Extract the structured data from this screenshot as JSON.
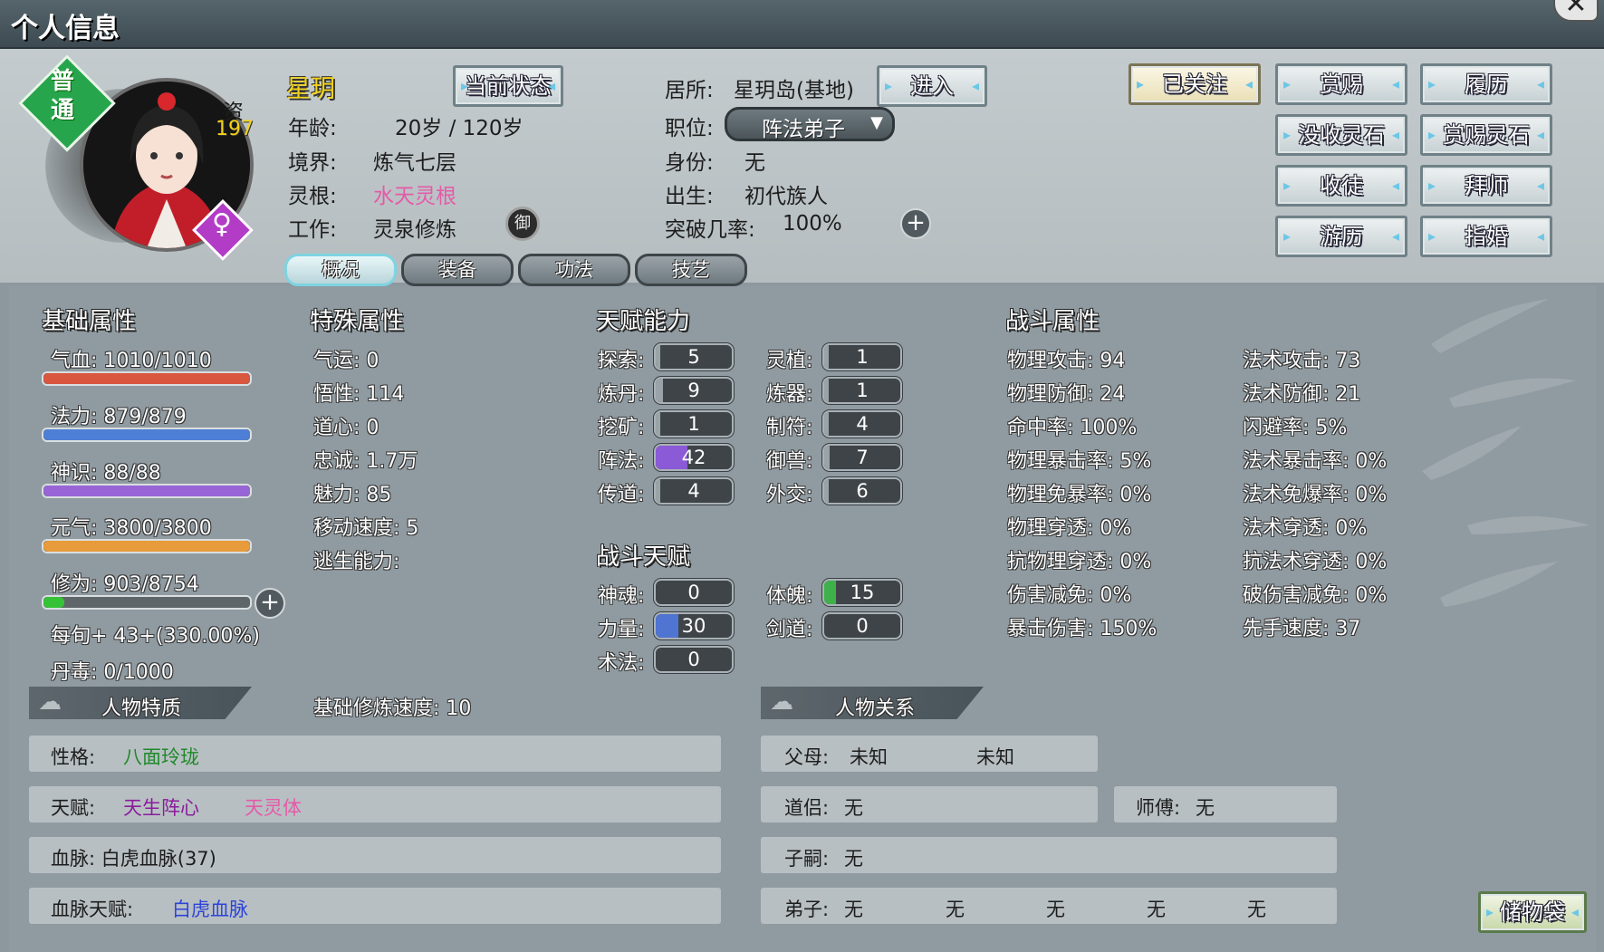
{
  "window": {
    "title": "个人信息"
  },
  "avatar": {
    "rank_badge": "普通",
    "zi_label": "资",
    "zi_value": "197",
    "gender_symbol": "♀"
  },
  "profile": {
    "name": "星玥",
    "status_button": "当前状态",
    "age_label": "年龄:",
    "age_value": "20岁 / 120岁",
    "realm_label": "境界:",
    "realm_value": "炼气七层",
    "root_label": "灵根:",
    "root_value": "水天灵根",
    "job_label": "工作:",
    "job_value": "灵泉修炼",
    "job_icon_text": "御",
    "residence_label": "居所:",
    "residence_value": "星玥岛(基地)",
    "enter_button": "进入",
    "position_label": "职位:",
    "position_value": "阵法弟子",
    "identity_label": "身份:",
    "identity_value": "无",
    "birth_label": "出生:",
    "birth_value": "初代族人",
    "breakthrough_label": "突破几率:",
    "breakthrough_value": "100%"
  },
  "actions": [
    "已关注",
    "赏赐",
    "履历",
    "没收灵石",
    "赏赐灵石",
    "收徒",
    "拜师",
    "游历",
    "指婚"
  ],
  "tabs": [
    "概况",
    "装备",
    "功法",
    "技艺"
  ],
  "basic": {
    "title": "基础属性",
    "hp": {
      "text": "气血: 1010/1010",
      "fraction": 1.0,
      "color": "#d9563f"
    },
    "mana": {
      "text": "法力: 879/879",
      "fraction": 1.0,
      "color": "#4d7fd6"
    },
    "spirit": {
      "text": "神识: 88/88",
      "fraction": 1.0,
      "color": "#9865d6"
    },
    "vital": {
      "text": "元气: 3800/3800",
      "fraction": 1.0,
      "color": "#e79b3a"
    },
    "cultivation": {
      "text": "修为: 903/8754",
      "fraction": 0.103,
      "color": "#36c236"
    },
    "per_turn": "每旬+ 43+(330.00%)",
    "poison": "丹毒: 0/1000"
  },
  "special": {
    "title": "特殊属性",
    "items": [
      "气运: 0",
      "悟性: 114",
      "道心: 0",
      "忠诚: 1.7万",
      "魅力: 85",
      "移动速度: 5",
      "逃生能力:"
    ],
    "base_speed": "基础修炼速度: 10"
  },
  "talent": {
    "title": "天赋能力",
    "left": [
      {
        "label": "探索:",
        "value": "5",
        "fill": 0.05
      },
      {
        "label": "炼丹:",
        "value": "9",
        "fill": 0.09
      },
      {
        "label": "挖矿:",
        "value": "1",
        "fill": 0.01
      },
      {
        "label": "阵法:",
        "value": "42",
        "fill": 0.42
      },
      {
        "label": "传道:",
        "value": "4",
        "fill": 0.04
      }
    ],
    "right": [
      {
        "label": "灵植:",
        "value": "1",
        "fill": 0.01
      },
      {
        "label": "炼器:",
        "value": "1",
        "fill": 0.01
      },
      {
        "label": "制符:",
        "value": "4",
        "fill": 0.04
      },
      {
        "label": "御兽:",
        "value": "7",
        "fill": 0.07
      },
      {
        "label": "外交:",
        "value": "6",
        "fill": 0.06
      }
    ]
  },
  "combat_talent": {
    "title": "战斗天赋",
    "left": [
      {
        "label": "神魂:",
        "value": "0",
        "fill": 0
      },
      {
        "label": "力量:",
        "value": "30",
        "fill": 0.3
      },
      {
        "label": "术法:",
        "value": "0",
        "fill": 0
      }
    ],
    "right": [
      {
        "label": "体魄:",
        "value": "15",
        "fill": 0.15
      },
      {
        "label": "剑道:",
        "value": "0",
        "fill": 0
      }
    ]
  },
  "combat": {
    "title": "战斗属性",
    "left": [
      "物理攻击: 94",
      "物理防御: 24",
      "命中率: 100%",
      "物理暴击率: 5%",
      "物理免暴率: 0%",
      "物理穿透: 0%",
      "抗物理穿透: 0%",
      "伤害减免: 0%",
      "暴击伤害: 150%"
    ],
    "right": [
      "法术攻击: 73",
      "法术防御: 21",
      "闪避率: 5%",
      "法术暴击率: 0%",
      "法术免爆率: 0%",
      "法术穿透: 0%",
      "抗法术穿透: 0%",
      "破伤害减免: 0%",
      "先手速度: 37"
    ]
  },
  "traits": {
    "title": "人物特质",
    "personality_label": "性格:",
    "personality_value": "八面玲珑",
    "gift_label": "天赋:",
    "gift_1": "天生阵心",
    "gift_2": "天灵体",
    "bloodline": "血脉: 白虎血脉(37)",
    "bloodline_gift_label": "血脉天赋:",
    "bloodline_gift_value": "白虎血脉"
  },
  "relations": {
    "title": "人物关系",
    "parents_label": "父母:",
    "parent_1": "未知",
    "parent_2": "未知",
    "partner_label": "道侣:",
    "partner_value": "无",
    "master_label": "师傅:",
    "master_value": "无",
    "children_label": "子嗣:",
    "children_value": "无",
    "disciples_label": "弟子:",
    "disciples": [
      "无",
      "无",
      "无",
      "无",
      "无"
    ]
  },
  "storage_button": "储物袋",
  "colors": {
    "name": "#f2d21c",
    "pink": "#e55aa8",
    "green": "#1f8a2a",
    "purple": "#8a1d9c",
    "blue": "#2d44d8"
  }
}
